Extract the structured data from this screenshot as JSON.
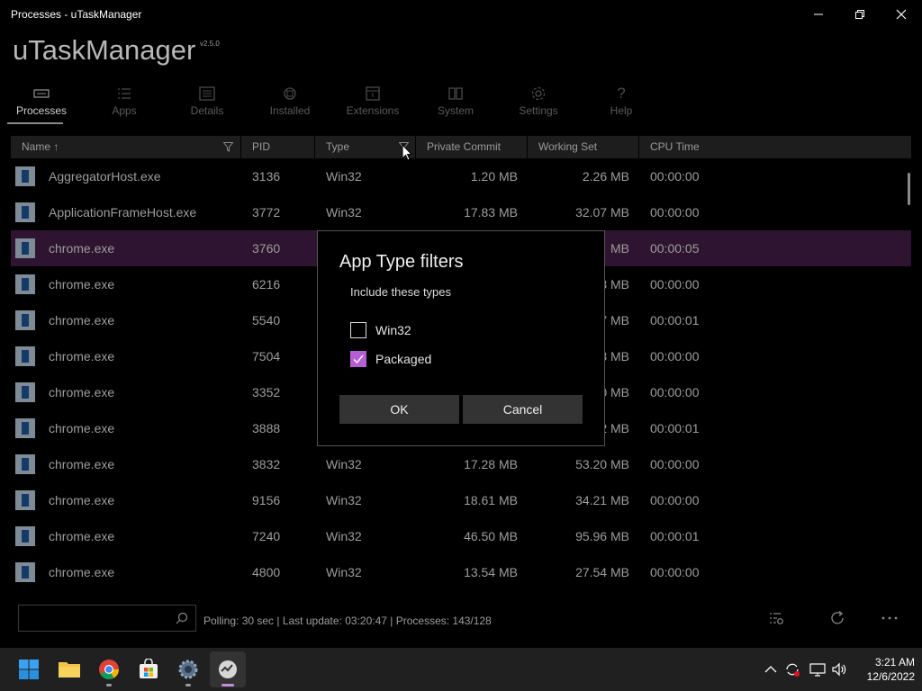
{
  "window": {
    "title": "Processes - uTaskManager",
    "minimize_icon": "minimize-icon",
    "maximize_icon": "restore-icon",
    "close_icon": "close-icon"
  },
  "app": {
    "name": "uTaskManager",
    "version": "v2.5.0"
  },
  "nav": [
    {
      "label": "Processes",
      "icon": "processes-icon",
      "active": true
    },
    {
      "label": "Apps",
      "icon": "apps-list-icon",
      "active": false
    },
    {
      "label": "Details",
      "icon": "details-icon",
      "active": false
    },
    {
      "label": "Installed",
      "icon": "installed-icon",
      "active": false
    },
    {
      "label": "Extensions",
      "icon": "extensions-icon",
      "active": false
    },
    {
      "label": "System",
      "icon": "system-icon",
      "active": false
    },
    {
      "label": "Settings",
      "icon": "gear-icon",
      "active": false
    },
    {
      "label": "Help",
      "icon": "help-icon",
      "active": false
    }
  ],
  "table": {
    "columns": [
      "Name ↑",
      "PID",
      "Type",
      "Private Commit",
      "Working Set",
      "CPU Time"
    ],
    "rows": [
      {
        "name": "AggregatorHost.exe",
        "pid": "3136",
        "type": "Win32",
        "private": "1.20 MB",
        "working": "2.26 MB",
        "cpu": "00:00:00"
      },
      {
        "name": "ApplicationFrameHost.exe",
        "pid": "3772",
        "type": "Win32",
        "private": "17.83 MB",
        "working": "32.07 MB",
        "cpu": "00:00:00"
      },
      {
        "name": "chrome.exe",
        "pid": "3760",
        "type": "",
        "private": "",
        "working": "MB",
        "cpu": "00:00:05"
      },
      {
        "name": "chrome.exe",
        "pid": "6216",
        "type": "",
        "private": "",
        "working": "3 MB",
        "cpu": "00:00:00"
      },
      {
        "name": "chrome.exe",
        "pid": "5540",
        "type": "",
        "private": "",
        "working": "7 MB",
        "cpu": "00:00:01"
      },
      {
        "name": "chrome.exe",
        "pid": "7504",
        "type": "",
        "private": "",
        "working": "3 MB",
        "cpu": "00:00:00"
      },
      {
        "name": "chrome.exe",
        "pid": "3352",
        "type": "",
        "private": "",
        "working": "0 MB",
        "cpu": "00:00:00"
      },
      {
        "name": "chrome.exe",
        "pid": "3888",
        "type": "",
        "private": "",
        "working": "2 MB",
        "cpu": "00:00:01"
      },
      {
        "name": "chrome.exe",
        "pid": "3832",
        "type": "Win32",
        "private": "17.28 MB",
        "working": "53.20 MB",
        "cpu": "00:00:00"
      },
      {
        "name": "chrome.exe",
        "pid": "9156",
        "type": "Win32",
        "private": "18.61 MB",
        "working": "34.21 MB",
        "cpu": "00:00:00"
      },
      {
        "name": "chrome.exe",
        "pid": "7240",
        "type": "Win32",
        "private": "46.50 MB",
        "working": "95.96 MB",
        "cpu": "00:00:01"
      },
      {
        "name": "chrome.exe",
        "pid": "4800",
        "type": "Win32",
        "private": "13.54 MB",
        "working": "27.54 MB",
        "cpu": "00:00:00"
      }
    ],
    "selected_index": 2
  },
  "dialog": {
    "title": "App Type filters",
    "subtitle": "Include these types",
    "options": [
      {
        "label": "Win32",
        "checked": false
      },
      {
        "label": "Packaged",
        "checked": true
      }
    ],
    "ok_label": "OK",
    "cancel_label": "Cancel"
  },
  "statusbar": {
    "search_value": "",
    "search_icon": "search-icon",
    "status_text": "Polling: 30 sec | Last update: 03:20:47 | Processes: 143/128",
    "buttons": [
      "filter-settings-icon",
      "refresh-icon",
      "more-icon"
    ]
  },
  "taskbar": {
    "apps": [
      "windows-start-icon",
      "file-explorer-icon",
      "chrome-icon",
      "microsoft-store-icon",
      "settings-icon",
      "utaskmanager-icon"
    ],
    "active_app": "utaskmanager-icon",
    "tray": [
      "chevron-up-icon",
      "sync-icon",
      "network-icon",
      "volume-icon"
    ],
    "time": "3:21 AM",
    "date": "12/6/2022"
  },
  "colors": {
    "accent": "#b65ed3",
    "selected_row": "#2e1430",
    "background": "#000000"
  }
}
